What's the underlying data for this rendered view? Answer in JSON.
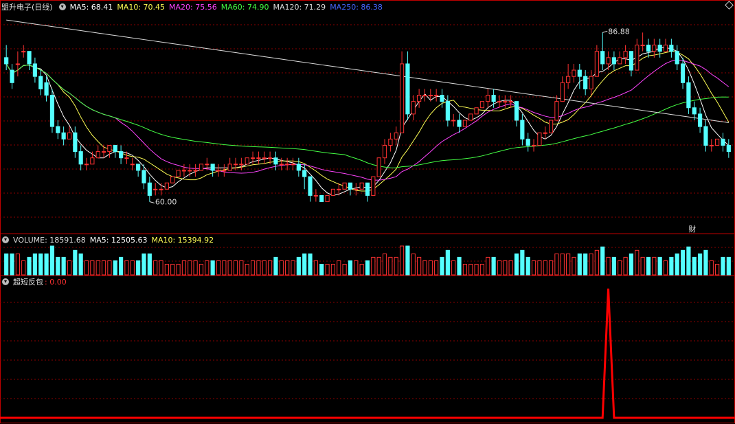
{
  "header": {
    "title": "盟升电子(日线)",
    "ma": [
      {
        "label": "MA5: 68.41",
        "color": "#ffffff"
      },
      {
        "label": "MA10: 70.45",
        "color": "#ffff55"
      },
      {
        "label": "MA20: 75.56",
        "color": "#ff44ff"
      },
      {
        "label": "MA60: 74.90",
        "color": "#44ff44"
      },
      {
        "label": "MA120: 71.29",
        "color": "#dddddd"
      },
      {
        "label": "MA250: 86.38",
        "color": "#4466ff"
      }
    ]
  },
  "price_panel": {
    "high_label": "86.88",
    "low_label": "60.00",
    "event_label": "财"
  },
  "volume_panel": {
    "title": "VOLUME: 18591.68",
    "ma5": "MA5: 12505.63",
    "ma10": "MA10: 15394.92"
  },
  "indicator_panel": {
    "title": "超短反包",
    "value": ": 0.00"
  },
  "colors": {
    "up": "#ff3232",
    "down": "#54ffff",
    "grid": "#8b0000"
  },
  "chart_data": {
    "type": "candlestick",
    "candles": [
      [
        83,
        85,
        82,
        81
      ],
      [
        81,
        82,
        79,
        78
      ],
      [
        82,
        84,
        82,
        80
      ],
      [
        84,
        85,
        84,
        83
      ],
      [
        84,
        84,
        82,
        81
      ],
      [
        82,
        83,
        80,
        79
      ],
      [
        80,
        81,
        78,
        77
      ],
      [
        79,
        80,
        77,
        76
      ],
      [
        77,
        78,
        72,
        71
      ],
      [
        72,
        73,
        71,
        70
      ],
      [
        71,
        72,
        70,
        69
      ],
      [
        70,
        72,
        71,
        70
      ],
      [
        71,
        72,
        68,
        67
      ],
      [
        68,
        69,
        66,
        65
      ],
      [
        66,
        67,
        66,
        65
      ],
      [
        66,
        68,
        67,
        66
      ],
      [
        67,
        69,
        68,
        67
      ],
      [
        68,
        69,
        68,
        67
      ],
      [
        68,
        69,
        69,
        67
      ],
      [
        69,
        69,
        68,
        67
      ],
      [
        68,
        69,
        67,
        66
      ],
      [
        67,
        68,
        67,
        66
      ],
      [
        66,
        67,
        66,
        65
      ],
      [
        66,
        66,
        65,
        64
      ],
      [
        65,
        66,
        63,
        62
      ],
      [
        63,
        64,
        61,
        60
      ],
      [
        62,
        63,
        62,
        61
      ],
      [
        62,
        63,
        62,
        61
      ],
      [
        62,
        63,
        63,
        62
      ],
      [
        63,
        64,
        64,
        63
      ],
      [
        64,
        65,
        65,
        64
      ],
      [
        65,
        66,
        65,
        64
      ],
      [
        65,
        66,
        65,
        64
      ],
      [
        65,
        66,
        65,
        64
      ],
      [
        65,
        66,
        66,
        65
      ],
      [
        66,
        67,
        66,
        65
      ],
      [
        66,
        66,
        65,
        64
      ],
      [
        65,
        66,
        65,
        64
      ],
      [
        65,
        66,
        65,
        64
      ],
      [
        65,
        67,
        66,
        65
      ],
      [
        66,
        67,
        66,
        65
      ],
      [
        66,
        67,
        66,
        65
      ],
      [
        66,
        67,
        67,
        66
      ],
      [
        67,
        68,
        67,
        66
      ],
      [
        67,
        68,
        67,
        66
      ],
      [
        67,
        68,
        67,
        66
      ],
      [
        67,
        68,
        67,
        66
      ],
      [
        67,
        68,
        66,
        65
      ],
      [
        66,
        67,
        66,
        65
      ],
      [
        66,
        67,
        66,
        65
      ],
      [
        66,
        67,
        66,
        65
      ],
      [
        66,
        67,
        65,
        64
      ],
      [
        65,
        66,
        64,
        62
      ],
      [
        64,
        64,
        61,
        60
      ],
      [
        61,
        62,
        61,
        60
      ],
      [
        61,
        61,
        60,
        60
      ],
      [
        60,
        61,
        61,
        60
      ],
      [
        61,
        62,
        62,
        61
      ],
      [
        62,
        63,
        62,
        61
      ],
      [
        62,
        63,
        63,
        62
      ],
      [
        63,
        63,
        62,
        61
      ],
      [
        62,
        63,
        62,
        61
      ],
      [
        62,
        63,
        63,
        62
      ],
      [
        63,
        62,
        61,
        60
      ],
      [
        61,
        64,
        64,
        61
      ],
      [
        64,
        67,
        67,
        64
      ],
      [
        67,
        70,
        69,
        66
      ],
      [
        69,
        71,
        70,
        68
      ],
      [
        70,
        72,
        71,
        69
      ],
      [
        71,
        84,
        82,
        71
      ],
      [
        82,
        84,
        74,
        73
      ],
      [
        74,
        77,
        76,
        73
      ],
      [
        76,
        78,
        77,
        75
      ],
      [
        77,
        78,
        77,
        76
      ],
      [
        77,
        78,
        77,
        76
      ],
      [
        77,
        78,
        77,
        76
      ],
      [
        77,
        78,
        76,
        75
      ],
      [
        76,
        77,
        73,
        72
      ],
      [
        73,
        74,
        73,
        72
      ],
      [
        73,
        74,
        72,
        71
      ],
      [
        72,
        73,
        73,
        72
      ],
      [
        73,
        74,
        74,
        73
      ],
      [
        74,
        75,
        75,
        74
      ],
      [
        75,
        76,
        76,
        75
      ],
      [
        76,
        78,
        77,
        75
      ],
      [
        77,
        78,
        76,
        75
      ],
      [
        76,
        77,
        76,
        75
      ],
      [
        76,
        77,
        76,
        75
      ],
      [
        76,
        77,
        76,
        75
      ],
      [
        76,
        76,
        73,
        72
      ],
      [
        73,
        74,
        70,
        69
      ],
      [
        70,
        71,
        69,
        68
      ],
      [
        69,
        70,
        69,
        68
      ],
      [
        69,
        71,
        71,
        69
      ],
      [
        71,
        72,
        71,
        70
      ],
      [
        71,
        73,
        73,
        71
      ],
      [
        73,
        77,
        76,
        73
      ],
      [
        76,
        80,
        79,
        76
      ],
      [
        79,
        82,
        80,
        78
      ],
      [
        80,
        82,
        81,
        79
      ],
      [
        81,
        82,
        80,
        78
      ],
      [
        80,
        81,
        78,
        77
      ],
      [
        78,
        81,
        80,
        77
      ],
      [
        80,
        85,
        84,
        80
      ],
      [
        84,
        87,
        82,
        81
      ],
      [
        82,
        84,
        83,
        81
      ],
      [
        83,
        84,
        82,
        81
      ],
      [
        82,
        84,
        83,
        82
      ],
      [
        83,
        85,
        84,
        82
      ],
      [
        84,
        84,
        81,
        80
      ],
      [
        81,
        86,
        85,
        81
      ],
      [
        85,
        87,
        85,
        84
      ],
      [
        85,
        86,
        84,
        83
      ],
      [
        84,
        86,
        85,
        83
      ],
      [
        85,
        86,
        84,
        83
      ],
      [
        84,
        86,
        85,
        84
      ],
      [
        85,
        86,
        84,
        83
      ],
      [
        84,
        85,
        82,
        81
      ],
      [
        82,
        83,
        79,
        78
      ],
      [
        79,
        80,
        75,
        74
      ],
      [
        75,
        76,
        74,
        73
      ],
      [
        74,
        75,
        72,
        71
      ],
      [
        72,
        73,
        69,
        68
      ],
      [
        69,
        70,
        69,
        68
      ],
      [
        69,
        70,
        70,
        69
      ],
      [
        70,
        71,
        69,
        68
      ],
      [
        69,
        70,
        68,
        67
      ]
    ],
    "ylim": [
      56,
      90
    ],
    "volume_ylim": [
      0,
      20000
    ],
    "indicator_ylim": [
      0,
      1
    ]
  }
}
